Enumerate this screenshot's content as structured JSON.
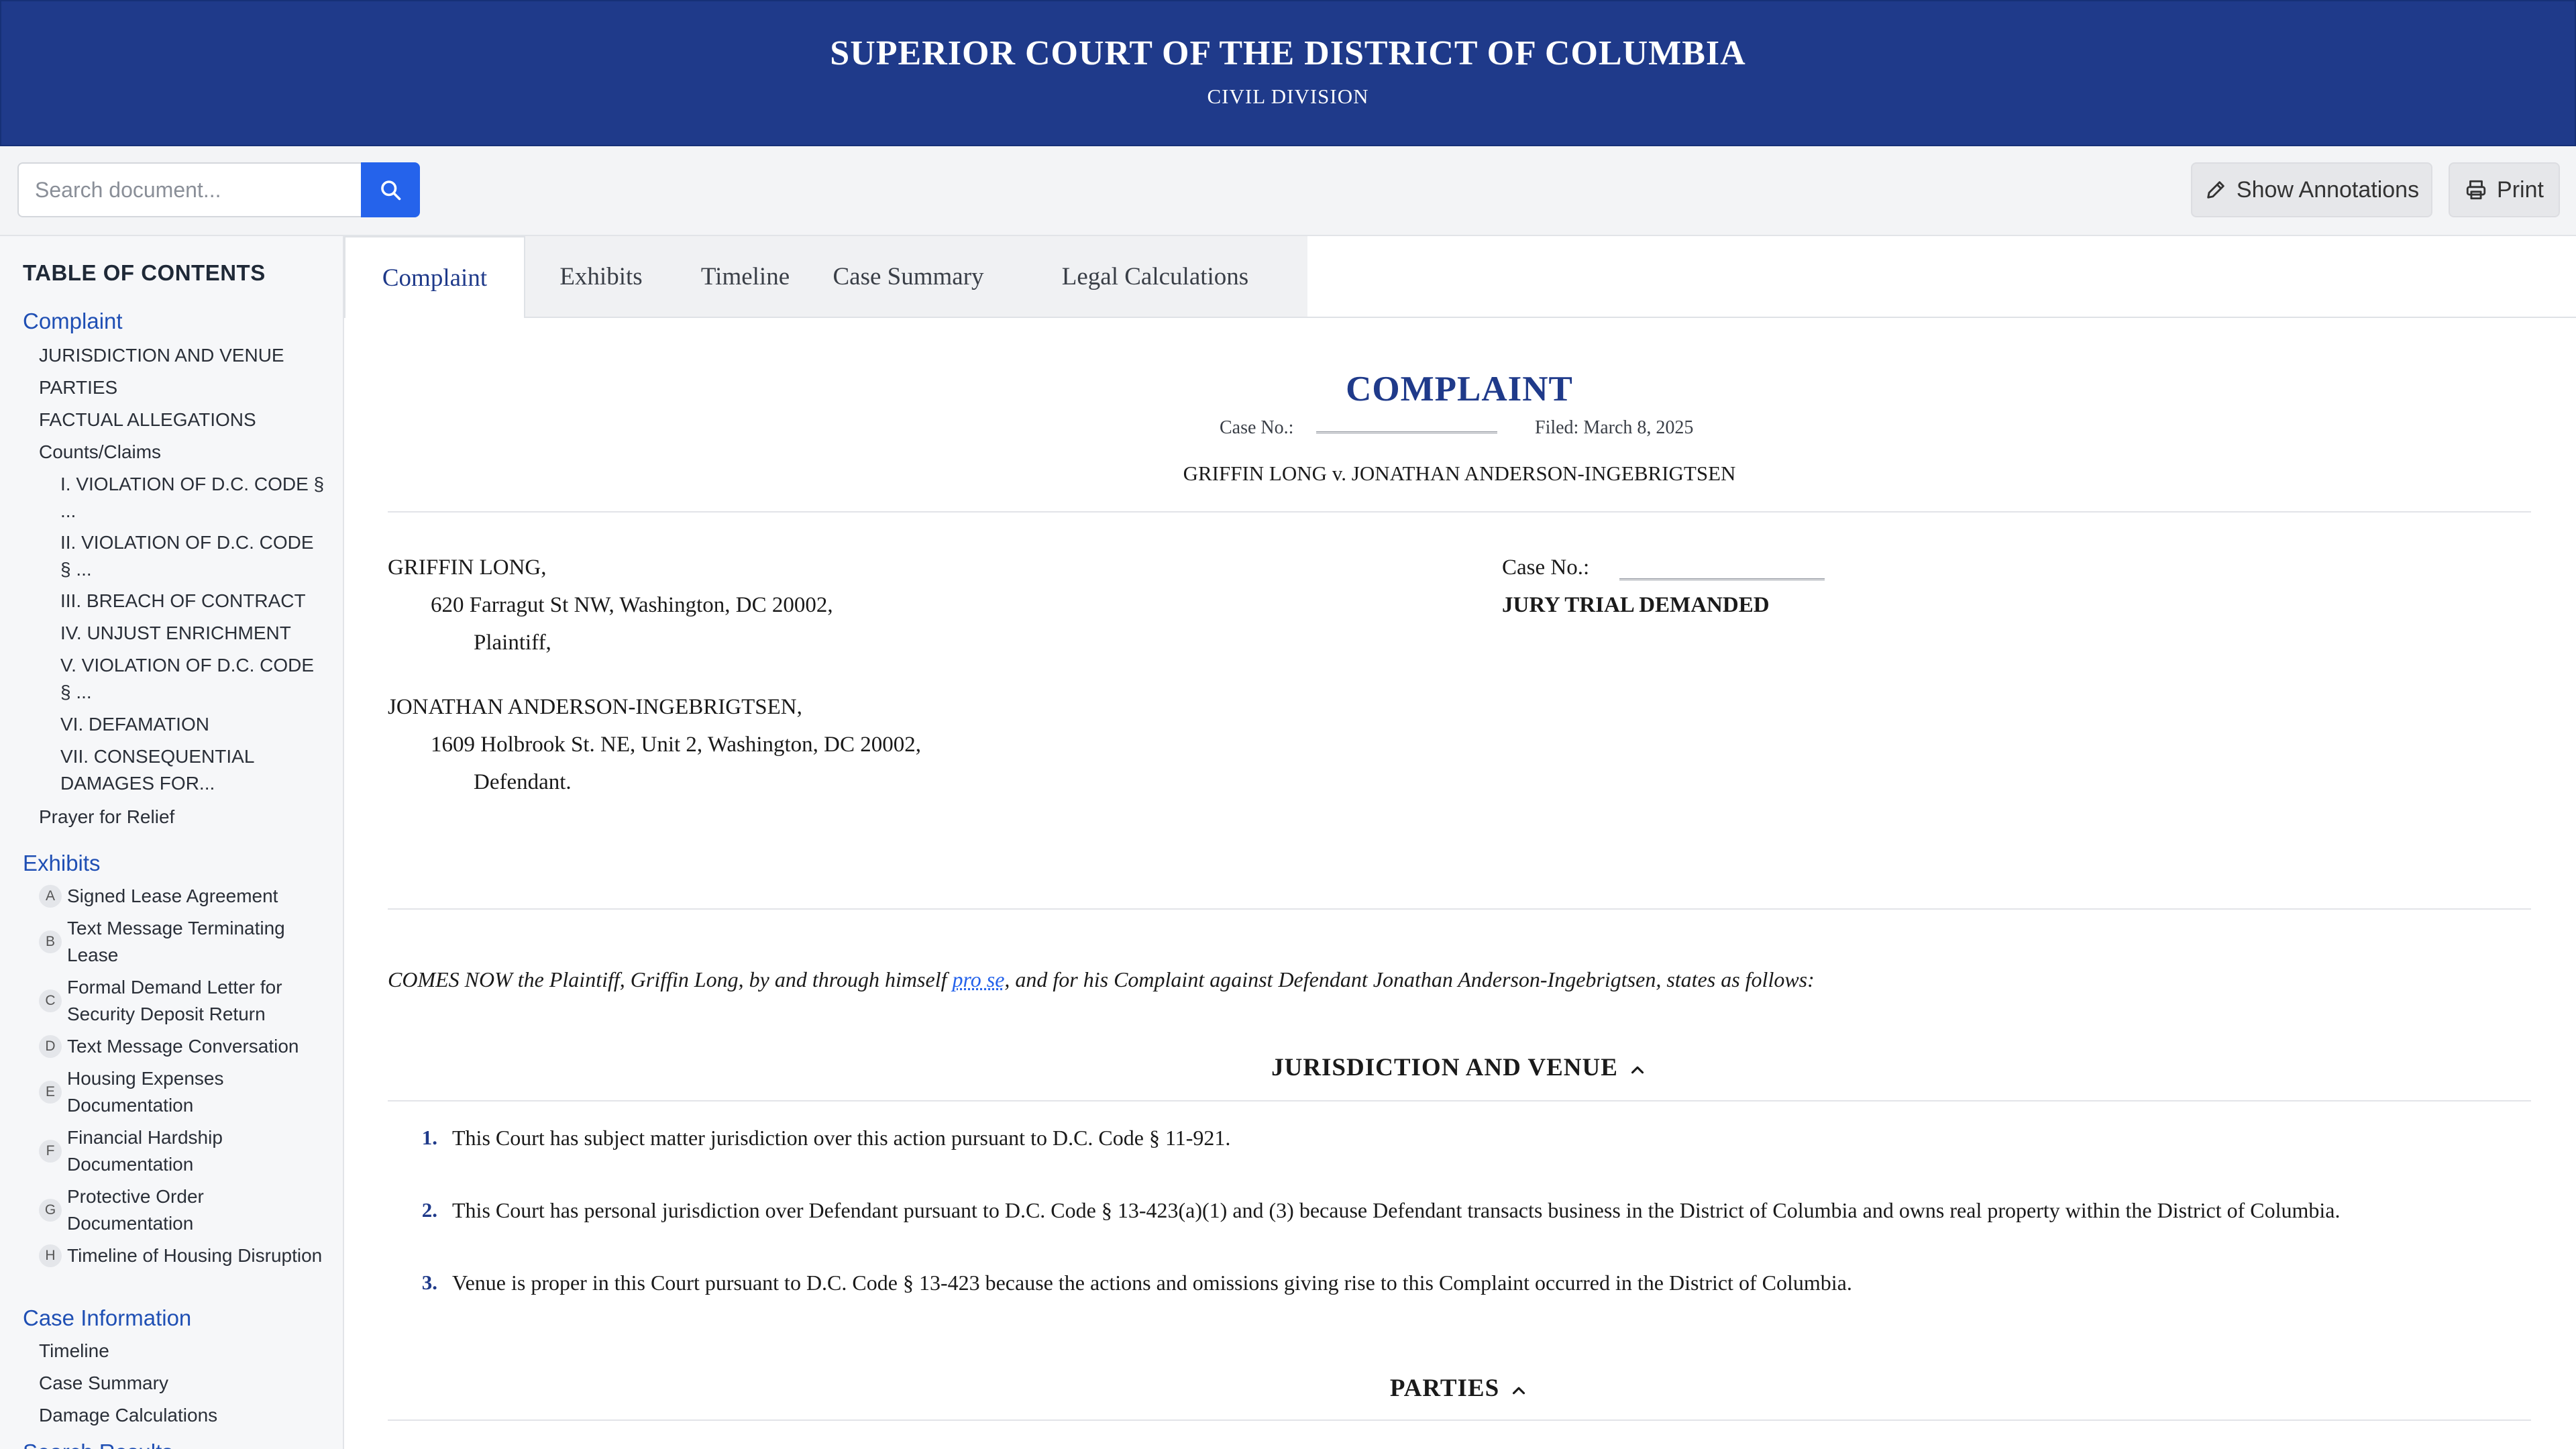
{
  "header": {
    "title": "SUPERIOR COURT OF THE DISTRICT OF COLUMBIA",
    "subtitle": "CIVIL DIVISION"
  },
  "toolbar": {
    "search_placeholder": "Search document...",
    "search_icon": "search-icon",
    "annotations_label": "Show Annotations",
    "annotations_icon": "pencil-icon",
    "print_label": "Print",
    "print_icon": "printer-icon"
  },
  "toc": {
    "title": "TABLE OF CONTENTS",
    "complaint": {
      "label": "Complaint",
      "items": [
        "JURISDICTION AND VENUE",
        "PARTIES",
        "FACTUAL ALLEGATIONS",
        "Counts/Claims"
      ],
      "counts": [
        "I. VIOLATION OF D.C. CODE § ...",
        "II. VIOLATION OF D.C. CODE § ...",
        "III. BREACH OF CONTRACT",
        "IV. UNJUST ENRICHMENT",
        "V. VIOLATION OF D.C. CODE § ...",
        "VI. DEFAMATION",
        "VII. CONSEQUENTIAL DAMAGES FOR..."
      ],
      "prayer": "Prayer for Relief"
    },
    "exhibits": {
      "label": "Exhibits",
      "items": [
        {
          "letter": "A",
          "label": "Signed Lease Agreement"
        },
        {
          "letter": "B",
          "label": "Text Message Terminating Lease"
        },
        {
          "letter": "C",
          "label": "Formal Demand Letter for Security Deposit Return"
        },
        {
          "letter": "D",
          "label": "Text Message Conversation"
        },
        {
          "letter": "E",
          "label": "Housing Expenses Documentation"
        },
        {
          "letter": "F",
          "label": "Financial Hardship Documentation"
        },
        {
          "letter": "G",
          "label": "Protective Order Documentation"
        },
        {
          "letter": "H",
          "label": "Timeline of Housing Disruption"
        }
      ]
    },
    "case_info": {
      "label": "Case Information",
      "items": [
        "Timeline",
        "Case Summary",
        "Damage Calculations"
      ]
    },
    "search_results_label": "Search Results"
  },
  "tabs": [
    "Complaint",
    "Exhibits",
    "Timeline",
    "Case Summary",
    "Legal Calculations"
  ],
  "document": {
    "title": "COMPLAINT",
    "case_no_label": "Case No.:",
    "filed": "Filed: March 8, 2025",
    "caption": "GRIFFIN LONG v. JONATHAN ANDERSON-INGEBRIGTSEN",
    "plaintiff": {
      "name": "GRIFFIN LONG,",
      "address": "620 Farragut St NW, Washington, DC 20002,",
      "role": "Plaintiff,"
    },
    "defendant": {
      "name": "JONATHAN ANDERSON-INGEBRIGTSEN,",
      "address": "1609 Holbrook St. NE, Unit 2, Washington, DC 20002,",
      "role": "Defendant."
    },
    "jury": "JURY TRIAL DEMANDED",
    "intro_before": "COMES NOW the Plaintiff, Griffin Long, by and through himself ",
    "intro_link": "pro se",
    "intro_after": ", and for his Complaint against Defendant Jonathan Anderson-Ingebrigtsen, states as follows:",
    "sections": [
      {
        "heading": "JURISDICTION AND VENUE",
        "paragraphs": [
          {
            "num": "1.",
            "text": "This Court has subject matter jurisdiction over this action pursuant to D.C. Code § 11-921."
          },
          {
            "num": "2.",
            "text": "This Court has personal jurisdiction over Defendant pursuant to D.C. Code § 13-423(a)(1) and (3) because Defendant transacts business in the District of Columbia and owns real property within the District of Columbia."
          },
          {
            "num": "3.",
            "text": "Venue is proper in this Court pursuant to D.C. Code § 13-423 because the actions and omissions giving rise to this Complaint occurred in the District of Columbia."
          }
        ]
      },
      {
        "heading": "PARTIES",
        "paragraphs": []
      }
    ]
  }
}
